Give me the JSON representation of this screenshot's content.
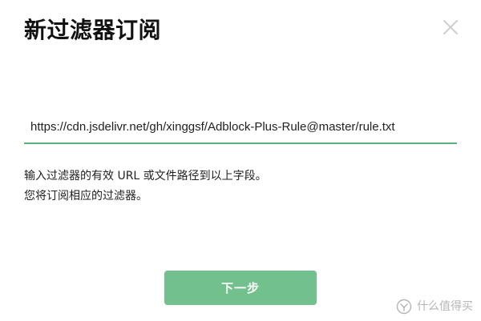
{
  "dialog": {
    "title": "新过滤器订阅",
    "close_icon": "close-icon",
    "url_value": "https://cdn.jsdelivr.net/gh/xinggsf/Adblock-Plus-Rule@master/rule.txt",
    "help_lines": [
      "输入过滤器的有效 URL 或文件路径到以上字段。",
      "您将订阅相应的过滤器。"
    ],
    "next_button": "下一步",
    "accent": "#5bb37a",
    "button_color": "#72c08d"
  },
  "watermark": {
    "text": "什么值得买",
    "icon": "zhide-logo-icon"
  }
}
